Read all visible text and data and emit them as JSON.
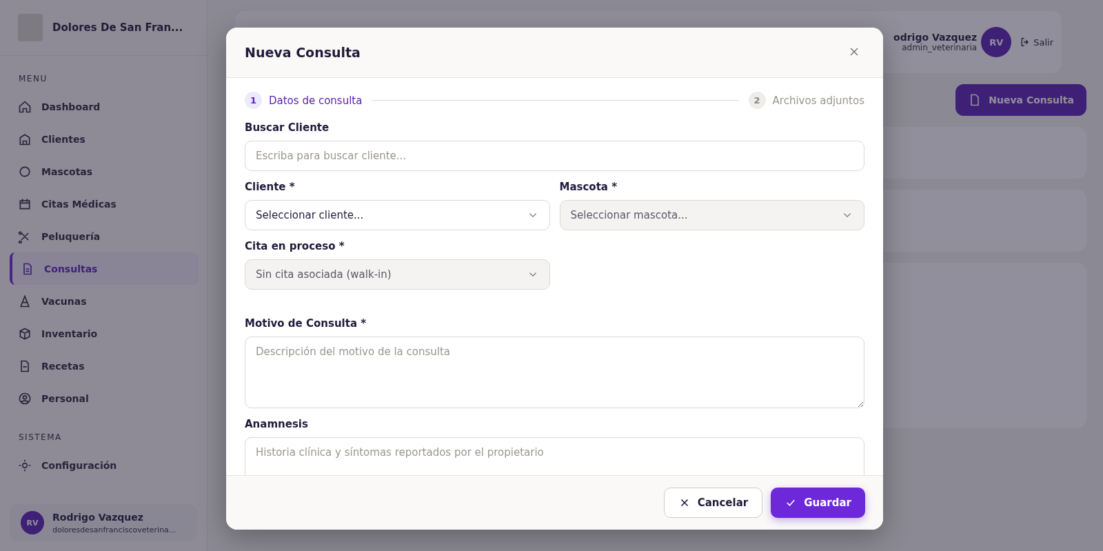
{
  "sidebar": {
    "brand": {
      "name": "Dolores De San Fran..."
    },
    "sections": [
      {
        "title": "MENU",
        "items": [
          {
            "label": "Dashboard",
            "selected": false
          },
          {
            "label": "Clientes",
            "selected": false
          },
          {
            "label": "Mascotas",
            "selected": false
          },
          {
            "label": "Citas Médicas",
            "selected": false
          },
          {
            "label": "Peluquería",
            "selected": false
          },
          {
            "label": "Consultas",
            "selected": true
          },
          {
            "label": "Vacunas",
            "selected": false
          },
          {
            "label": "Inventario",
            "selected": false
          },
          {
            "label": "Recetas",
            "selected": false
          },
          {
            "label": "Personal",
            "selected": false
          }
        ]
      },
      {
        "title": "SISTEMA",
        "items": [
          {
            "label": "Configuración",
            "selected": false
          }
        ]
      }
    ],
    "user": {
      "initials": "RV",
      "name": "Rodrigo Vazquez",
      "email": "doloresdesanfranciscoveterina..."
    }
  },
  "header": {
    "user": {
      "name": "odrigo Vazquez",
      "role": "admin_veterinaria",
      "initials": "RV"
    },
    "logout": "Salir",
    "new_button": "Nueva Consulta"
  },
  "modal": {
    "title": "Nueva Consulta",
    "steps": [
      {
        "number": "1",
        "label": "Datos de consulta",
        "selected": true
      },
      {
        "number": "2",
        "label": "Archivos adjuntos",
        "selected": false
      }
    ],
    "rows": [
      [
        {
          "kind": "text",
          "label": "Buscar Cliente",
          "placeholder": "Escriba para buscar cliente..."
        }
      ],
      [
        {
          "kind": "select",
          "label": "Cliente *",
          "value": "Seleccionar cliente...",
          "disabled": false
        },
        {
          "kind": "select",
          "label": "Mascota *",
          "value": "Seleccionar mascota...",
          "disabled": true
        }
      ],
      [
        {
          "kind": "select",
          "label": "Cita en proceso *",
          "value": "Sin cita asociada (walk-in)",
          "disabled": true
        }
      ],
      [
        {
          "kind": "textarea",
          "label": "Motivo de Consulta *",
          "placeholder": "Descripción del motivo de la consulta"
        }
      ],
      [
        {
          "kind": "textarea",
          "label": "Anamnesis",
          "placeholder": "Historia clínica y síntomas reportados por el propietario"
        }
      ]
    ],
    "buttons": [
      {
        "kind": "secondary",
        "label": "Cancelar"
      },
      {
        "kind": "primary",
        "label": "Guardar"
      }
    ]
  }
}
